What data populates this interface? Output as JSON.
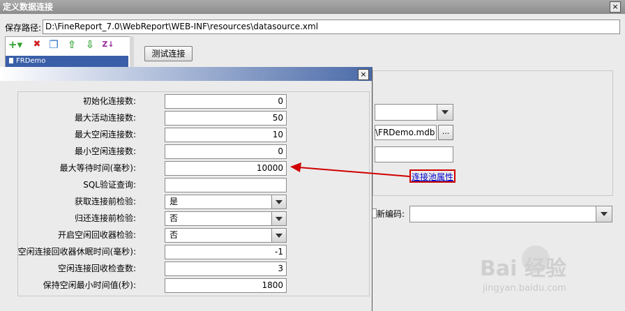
{
  "window": {
    "title": "定义数据连接",
    "close": "×"
  },
  "path": {
    "label": "保存路径:",
    "value": "D:\\FineReport_7.0\\WebReport\\WEB-INF\\resources\\datasource.xml"
  },
  "toolbar": {
    "add": "+▾",
    "delete": "✖",
    "copy": "❐",
    "up": "⇧",
    "down": "⇩",
    "sort": "Z↓"
  },
  "connections": [
    {
      "name": "FRDemo"
    }
  ],
  "test_button": "测试连接",
  "background": {
    "file_value": "\\FRDemo.mdb",
    "browse": "...",
    "pool_link": "连接池属性",
    "encoding_label": "新编码:"
  },
  "dialog": {
    "close": "×",
    "rows": [
      {
        "label": "初始化连接数:",
        "value": "0"
      },
      {
        "label": "最大活动连接数:",
        "value": "50"
      },
      {
        "label": "最大空闲连接数:",
        "value": "10"
      },
      {
        "label": "最小空闲连接数:",
        "value": "0"
      },
      {
        "label": "最大等待时间(毫秒):",
        "value": "10000"
      },
      {
        "label": "SQL验证查询:",
        "value": ""
      },
      {
        "label": "获取连接前检验:",
        "value": "是"
      },
      {
        "label": "归还连接前检验:",
        "value": "否"
      },
      {
        "label": "开启空闲回收器检验:",
        "value": "否"
      },
      {
        "label": "空闲连接回收器休眠时间(毫秒):",
        "value": "-1"
      },
      {
        "label": "空闲连接回收检查数:",
        "value": "3"
      },
      {
        "label": "保持空闲最小时间值(秒):",
        "value": "1800"
      }
    ]
  },
  "watermark": {
    "brand": "Bai 经验",
    "url": "jingyan.baidu.com"
  },
  "colors": {
    "arrow": "#d00000",
    "selection": "#3a5fa8",
    "link": "#0000cc"
  }
}
